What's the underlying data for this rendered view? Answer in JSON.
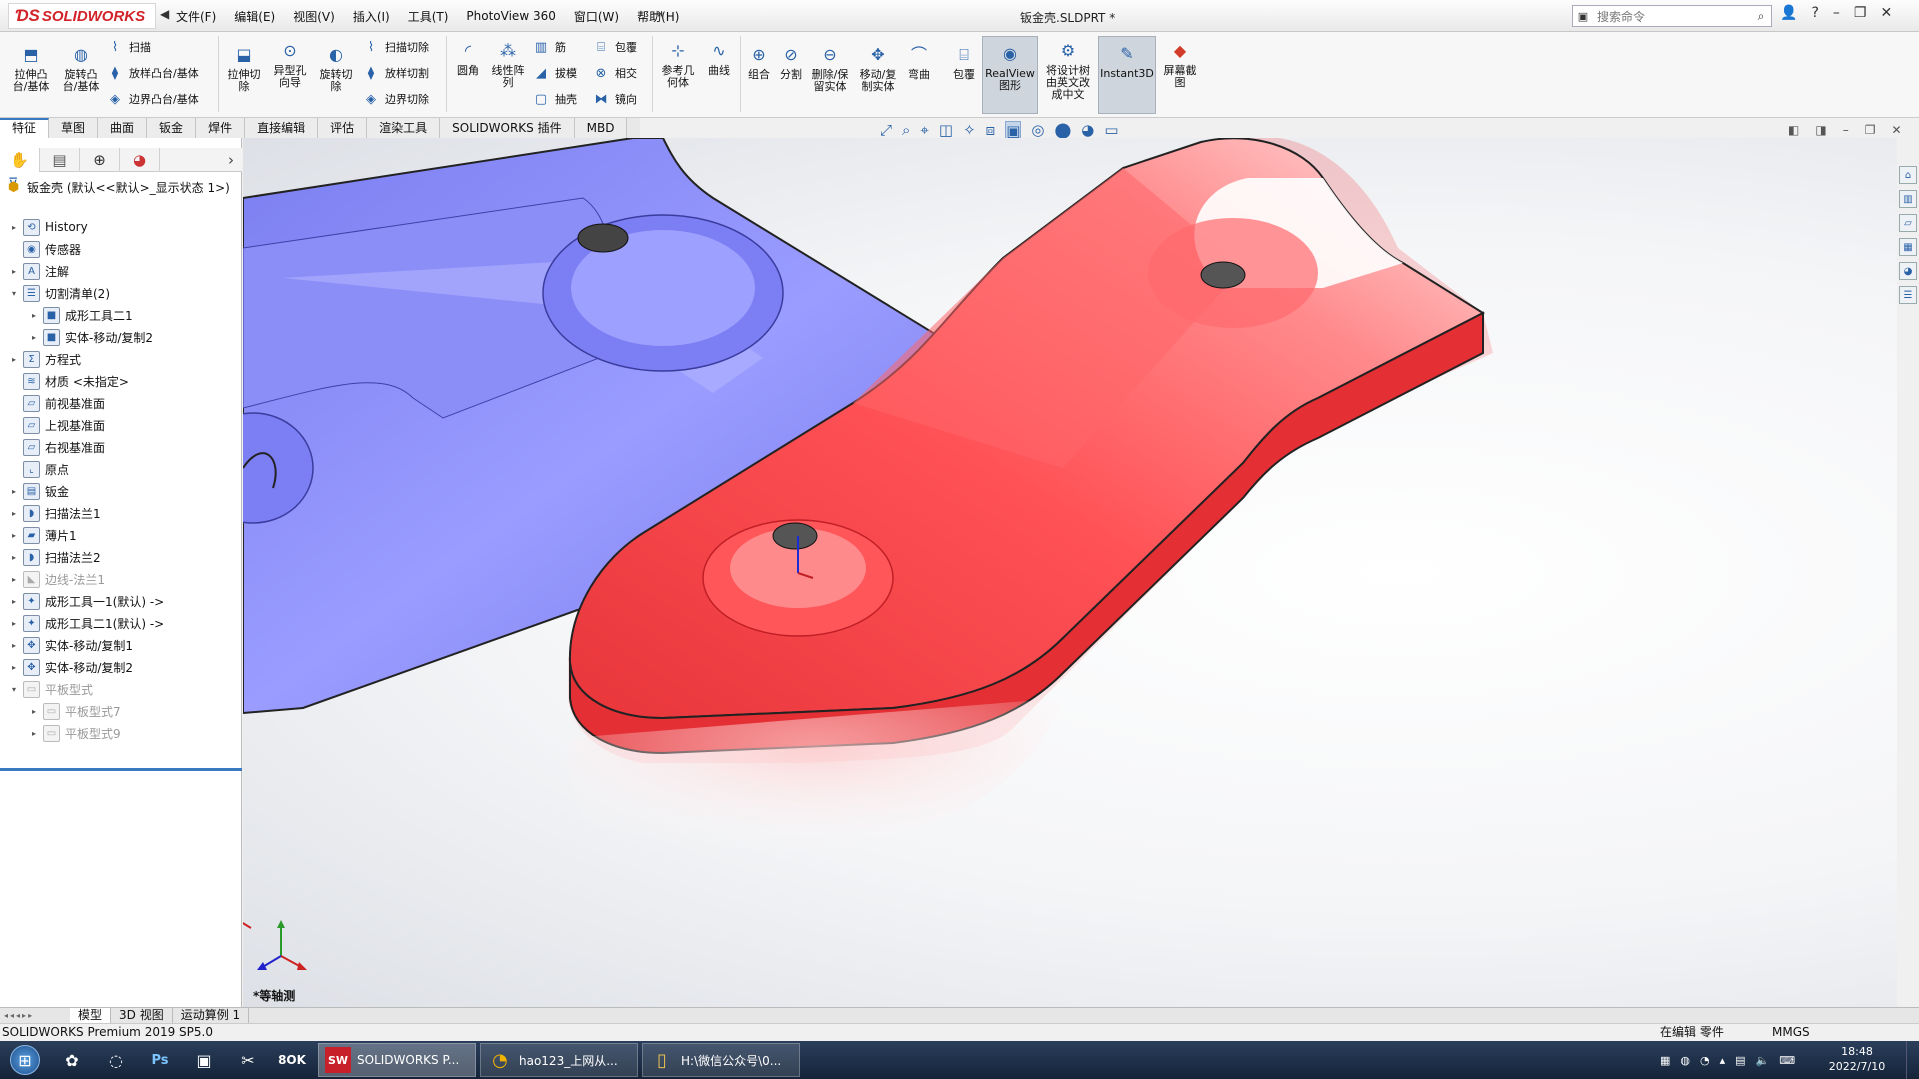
{
  "app": {
    "logo_text": "SOLIDWORKS",
    "document_title": "钣金壳.SLDPRT *",
    "search_placeholder": "搜索命令"
  },
  "menus": [
    "文件(F)",
    "编辑(E)",
    "视图(V)",
    "插入(I)",
    "工具(T)",
    "PhotoView 360",
    "窗口(W)",
    "帮助(H)"
  ],
  "ribbon": {
    "extrude_boss": "拉伸凸\n台/基体",
    "revolve_boss": "旋转凸\n台/基体",
    "sweep": "扫描",
    "loft_boss": "放样凸台/基体",
    "boundary_boss": "边界凸台/基体",
    "extrude_cut": "拉伸切\n除",
    "hole_wizard": "异型孔\n向导",
    "revolve_cut": "旋转切\n除",
    "sweep_cut": "扫描切除",
    "loft_cut": "放样切割",
    "boundary_cut": "边界切除",
    "fillet": "圆角",
    "linear_pattern": "线性阵\n列",
    "rib": "筋",
    "draft": "拔模",
    "shell": "抽壳",
    "wrap": "包覆",
    "intersect": "相交",
    "mirror": "镜向",
    "ref_geometry": "参考几\n何体",
    "curves": "曲线",
    "combine": "组合",
    "split": "分割",
    "delete_body": "删除/保\n留实体",
    "move_copy": "移动/复\n制实体",
    "flex": "弯曲",
    "wrap2": "包覆",
    "realview": "RealView\n图形",
    "translate_tree": "将设计树\n由英文改\n成中文",
    "instant3d": "Instant3D",
    "screen_capture": "屏幕截\n图"
  },
  "tabs": [
    "特征",
    "草图",
    "曲面",
    "钣金",
    "焊件",
    "直接编辑",
    "评估",
    "渲染工具",
    "SOLIDWORKS 插件",
    "MBD"
  ],
  "tree": {
    "root": "钣金壳  (默认<<默认>_显示状态 1>)",
    "items": [
      {
        "label": "History",
        "icon": "history-icon",
        "glyph": "⟲",
        "level": 1,
        "expand": "▸",
        "grey": false
      },
      {
        "label": "传感器",
        "icon": "sensor-icon",
        "glyph": "◉",
        "level": 1,
        "expand": "",
        "grey": false
      },
      {
        "label": "注解",
        "icon": "annotation-icon",
        "glyph": "A",
        "level": 1,
        "expand": "▸",
        "grey": false
      },
      {
        "label": "切割清单(2)",
        "icon": "cut-list-icon",
        "glyph": "☰",
        "level": 1,
        "expand": "▾",
        "grey": false
      },
      {
        "label": "成形工具二1",
        "icon": "solid-body-icon",
        "glyph": "■",
        "level": 2,
        "expand": "▸",
        "grey": false
      },
      {
        "label": "实体-移动/复制2",
        "icon": "solid-body-icon",
        "glyph": "■",
        "level": 2,
        "expand": "▸",
        "grey": false
      },
      {
        "label": "方程式",
        "icon": "equation-icon",
        "glyph": "Σ",
        "level": 1,
        "expand": "▸",
        "grey": false
      },
      {
        "label": "材质 <未指定>",
        "icon": "material-icon",
        "glyph": "≋",
        "level": 1,
        "expand": "",
        "grey": false
      },
      {
        "label": "前视基准面",
        "icon": "plane-icon",
        "glyph": "▱",
        "level": 1,
        "expand": "",
        "grey": false
      },
      {
        "label": "上视基准面",
        "icon": "plane-icon",
        "glyph": "▱",
        "level": 1,
        "expand": "",
        "grey": false
      },
      {
        "label": "右视基准面",
        "icon": "plane-icon",
        "glyph": "▱",
        "level": 1,
        "expand": "",
        "grey": false
      },
      {
        "label": "原点",
        "icon": "origin-icon",
        "glyph": "⌞",
        "level": 1,
        "expand": "",
        "grey": false
      },
      {
        "label": "钣金",
        "icon": "sheet-metal-icon",
        "glyph": "▤",
        "level": 1,
        "expand": "▸",
        "grey": false
      },
      {
        "label": "扫描法兰1",
        "icon": "swept-flange-icon",
        "glyph": "◗",
        "level": 1,
        "expand": "▸",
        "grey": false
      },
      {
        "label": "薄片1",
        "icon": "base-flange-icon",
        "glyph": "▰",
        "level": 1,
        "expand": "▸",
        "grey": false
      },
      {
        "label": "扫描法兰2",
        "icon": "swept-flange-icon",
        "glyph": "◗",
        "level": 1,
        "expand": "▸",
        "grey": false
      },
      {
        "label": "边线-法兰1",
        "icon": "edge-flange-icon",
        "glyph": "◣",
        "level": 1,
        "expand": "▸",
        "grey": true
      },
      {
        "label": "成形工具一1(默认) ->",
        "icon": "forming-tool-icon",
        "glyph": "✦",
        "level": 1,
        "expand": "▸",
        "grey": false
      },
      {
        "label": "成形工具二1(默认) ->",
        "icon": "forming-tool-icon",
        "glyph": "✦",
        "level": 1,
        "expand": "▸",
        "grey": false
      },
      {
        "label": "实体-移动/复制1",
        "icon": "move-copy-icon",
        "glyph": "✥",
        "level": 1,
        "expand": "▸",
        "grey": false
      },
      {
        "label": "实体-移动/复制2",
        "icon": "move-copy-icon",
        "glyph": "✥",
        "level": 1,
        "expand": "▸",
        "grey": false
      },
      {
        "label": "平板型式",
        "icon": "flat-pattern-icon",
        "glyph": "▭",
        "level": 1,
        "expand": "▾",
        "grey": true
      },
      {
        "label": "平板型式7",
        "icon": "flat-pattern-icon",
        "glyph": "▭",
        "level": 2,
        "expand": "▸",
        "grey": true
      },
      {
        "label": "平板型式9",
        "icon": "flat-pattern-icon",
        "glyph": "▭",
        "level": 2,
        "expand": "▸",
        "grey": true
      }
    ]
  },
  "viewport": {
    "view_label": "*等轴测",
    "part_colors": {
      "left_part": "#8a8cf5",
      "right_part": "#ef3b3f"
    }
  },
  "bottom_tabs": [
    "模型",
    "3D 视图",
    "运动算例 1"
  ],
  "status": {
    "product": "SOLIDWORKS Premium 2019 SP5.0",
    "mode": "在编辑 零件",
    "units": "MMGS"
  },
  "taskbar": {
    "tasks": [
      {
        "label": "SOLIDWORKS P...",
        "icon": "SW",
        "color": "#c8202a"
      },
      {
        "label": "hao123_上网从...",
        "icon": "◔",
        "color": "#f0b400"
      },
      {
        "label": "H:\\微信公众号\\0...",
        "icon": "▯",
        "color": "#e8c050"
      }
    ],
    "time": "18:48",
    "date": "2022/7/10"
  }
}
